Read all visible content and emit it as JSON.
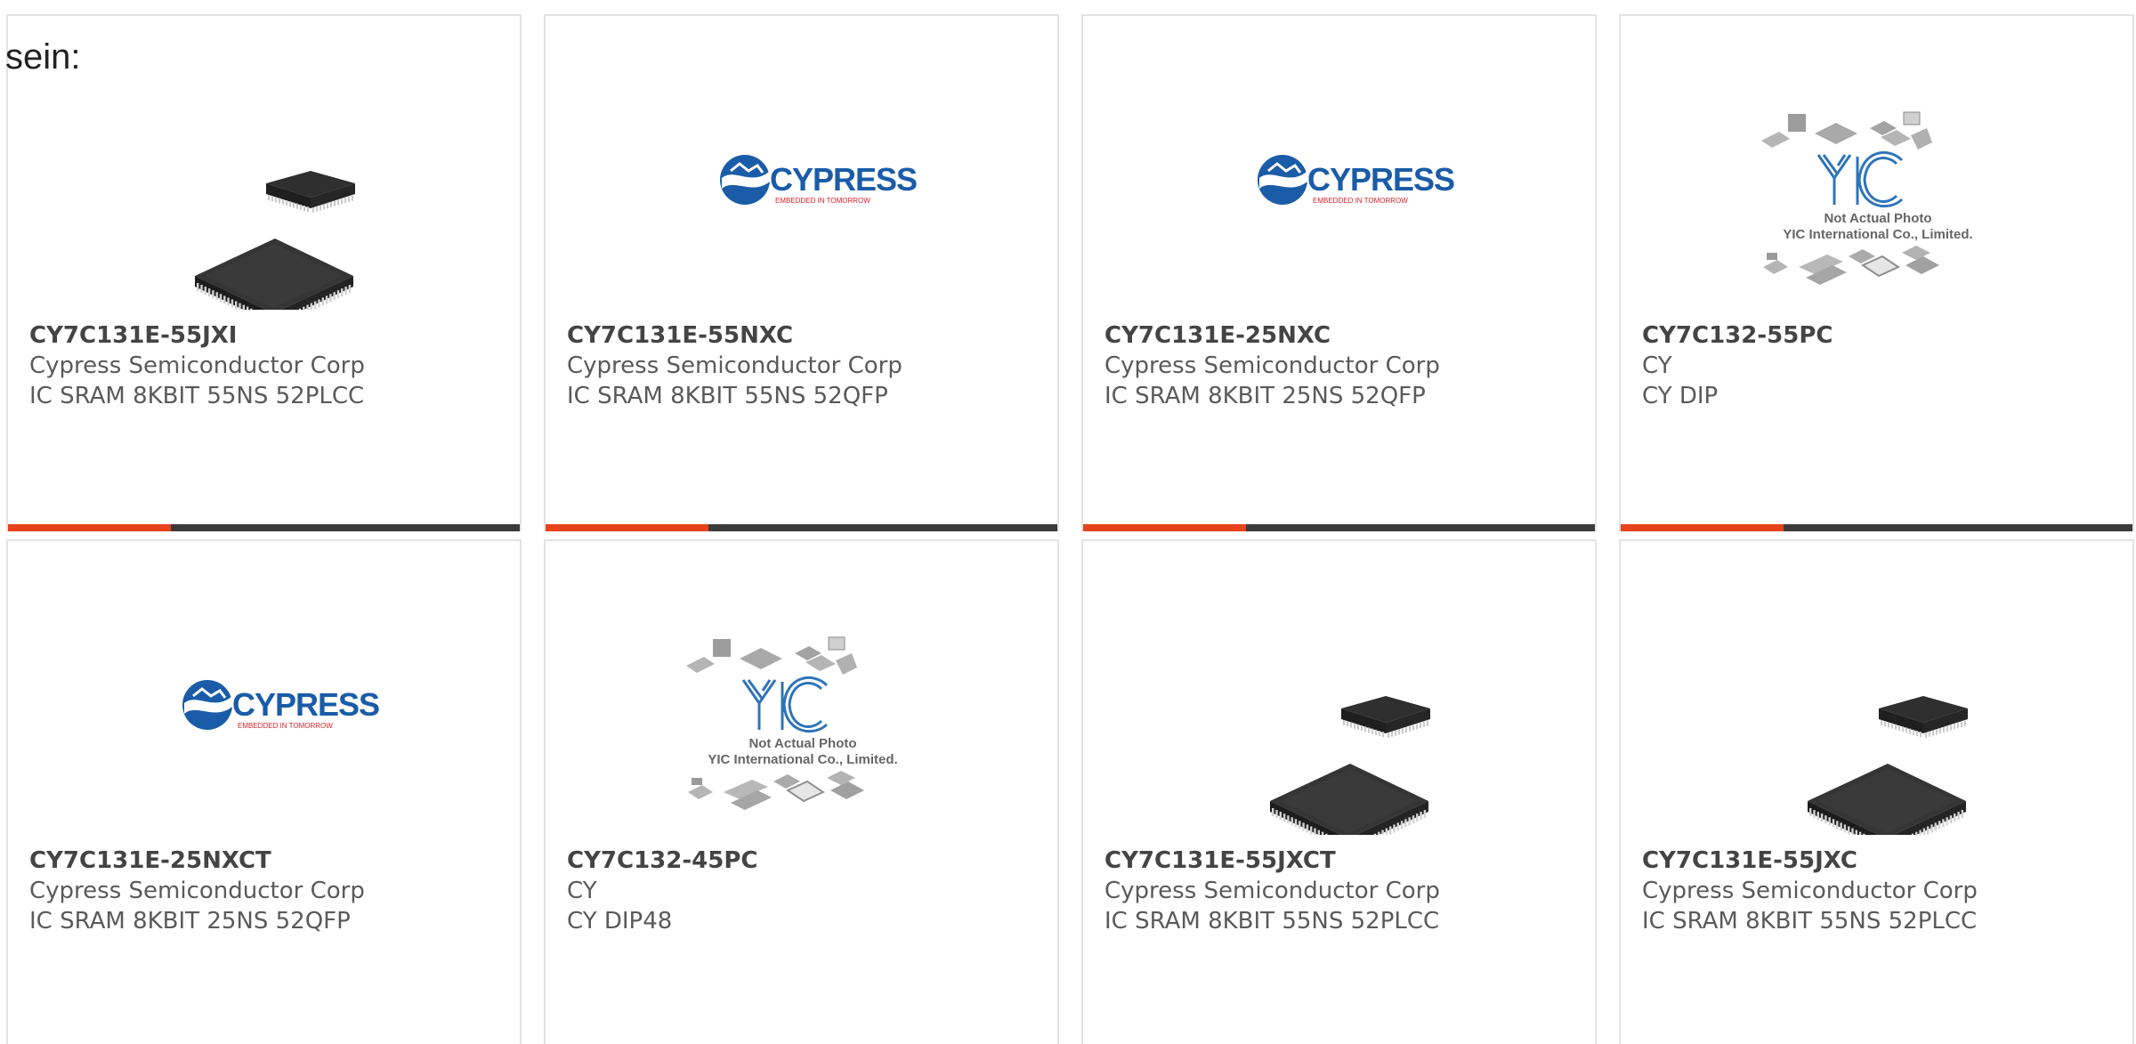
{
  "intro_text": "sein:",
  "colors": {
    "accent_bar": "#e8431c",
    "dark_bar": "#3b3b3b",
    "cypress_blue": "#1a5ca8",
    "cypress_red": "#d8232a",
    "yic_blue": "#2e74b8"
  },
  "products": [
    {
      "part": "CY7C131E-55JXI",
      "manufacturer": "Cypress Semiconductor Corp",
      "description": "IC SRAM 8KBIT 55NS 52PLCC",
      "image": "plcc-chip"
    },
    {
      "part": "CY7C131E-55NXC",
      "manufacturer": "Cypress Semiconductor Corp",
      "description": "IC SRAM 8KBIT 55NS 52QFP",
      "image": "cypress-logo"
    },
    {
      "part": "CY7C131E-25NXC",
      "manufacturer": "Cypress Semiconductor Corp",
      "description": "IC SRAM 8KBIT 25NS 52QFP",
      "image": "cypress-logo"
    },
    {
      "part": "CY7C132-55PC",
      "manufacturer": "CY",
      "description": "CY DIP",
      "image": "yic-placeholder"
    },
    {
      "part": "CY7C131E-25NXCT",
      "manufacturer": "Cypress Semiconductor Corp",
      "description": "IC SRAM 8KBIT 25NS 52QFP",
      "image": "cypress-logo"
    },
    {
      "part": "CY7C132-45PC",
      "manufacturer": "CY",
      "description": "CY DIP48",
      "image": "yic-placeholder"
    },
    {
      "part": "CY7C131E-55JXCT",
      "manufacturer": "Cypress Semiconductor Corp",
      "description": "IC SRAM 8KBIT 55NS 52PLCC",
      "image": "plcc-chip"
    },
    {
      "part": "CY7C131E-55JXC",
      "manufacturer": "Cypress Semiconductor Corp",
      "description": "IC SRAM 8KBIT 55NS 52PLCC",
      "image": "plcc-chip"
    }
  ],
  "logos": {
    "cypress": {
      "name": "CYPRESS",
      "tagline": "EMBEDDED IN TOMORROW"
    },
    "yic": {
      "mark": "YIC",
      "line1": "Not Actual Photo",
      "line2": "YIC International Co., Limited."
    }
  }
}
